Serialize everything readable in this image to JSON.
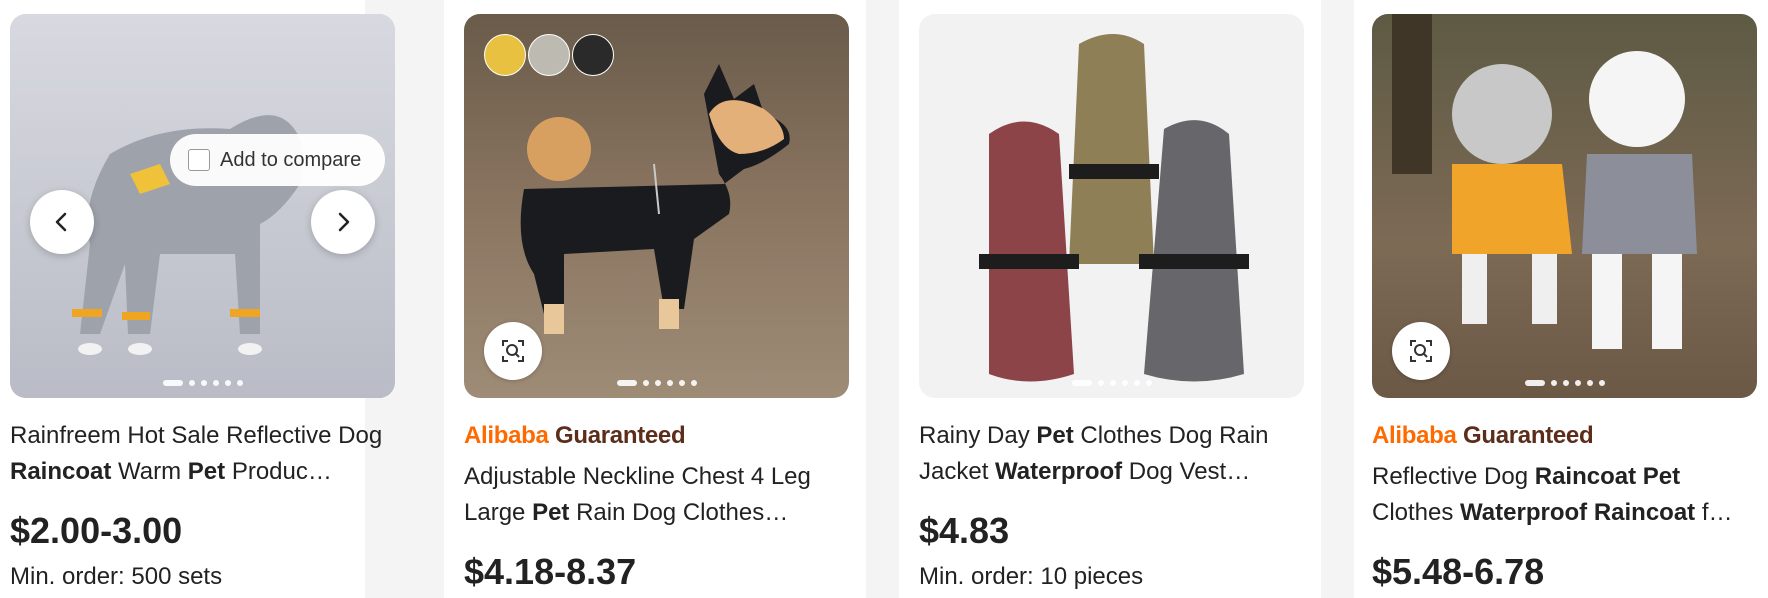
{
  "products": [
    {
      "title_parts": [
        {
          "text": "Rainfreem Hot Sale Reflective Dog ",
          "bold": false
        },
        {
          "text": "Raincoat",
          "bold": true
        },
        {
          "text": " Warm ",
          "bold": false
        },
        {
          "text": "Pet",
          "bold": true
        },
        {
          "text": " Produc…",
          "bold": false
        }
      ],
      "price": "$2.00-3.00",
      "moq": "Min. order: 500 sets",
      "compare_label": "Add to compare",
      "guaranteed": false
    },
    {
      "brand": "Alibaba",
      "guarantee_word": "Guaranteed",
      "title_parts": [
        {
          "text": "Adjustable Neckline Chest 4 Leg Large ",
          "bold": false
        },
        {
          "text": "Pet",
          "bold": true
        },
        {
          "text": " Rain Dog Clothes…",
          "bold": false
        }
      ],
      "price": "$4.18-8.37",
      "guaranteed": true
    },
    {
      "title_parts": [
        {
          "text": "Rainy Day ",
          "bold": false
        },
        {
          "text": "Pet",
          "bold": true
        },
        {
          "text": " Clothes Dog Rain Jacket ",
          "bold": false
        },
        {
          "text": "Waterproof",
          "bold": true
        },
        {
          "text": " Dog Vest…",
          "bold": false
        }
      ],
      "price": "$4.83",
      "moq": "Min. order: 10 pieces",
      "guaranteed": false
    },
    {
      "brand": "Alibaba",
      "guarantee_word": "Guaranteed",
      "title_parts": [
        {
          "text": "Reflective Dog ",
          "bold": false
        },
        {
          "text": "Raincoat Pet",
          "bold": true
        },
        {
          "text": " Clothes ",
          "bold": false
        },
        {
          "text": "Waterproof Raincoat",
          "bold": true
        },
        {
          "text": " f…",
          "bold": false
        }
      ],
      "price": "$5.48-6.78",
      "guaranteed": true
    }
  ],
  "icons": {
    "prev": "chevron-left-icon",
    "next": "chevron-right-icon",
    "lens": "image-search-icon"
  },
  "colors": {
    "brand_orange": "#ff6a00",
    "guarantee_brown": "#5b2d1a"
  }
}
